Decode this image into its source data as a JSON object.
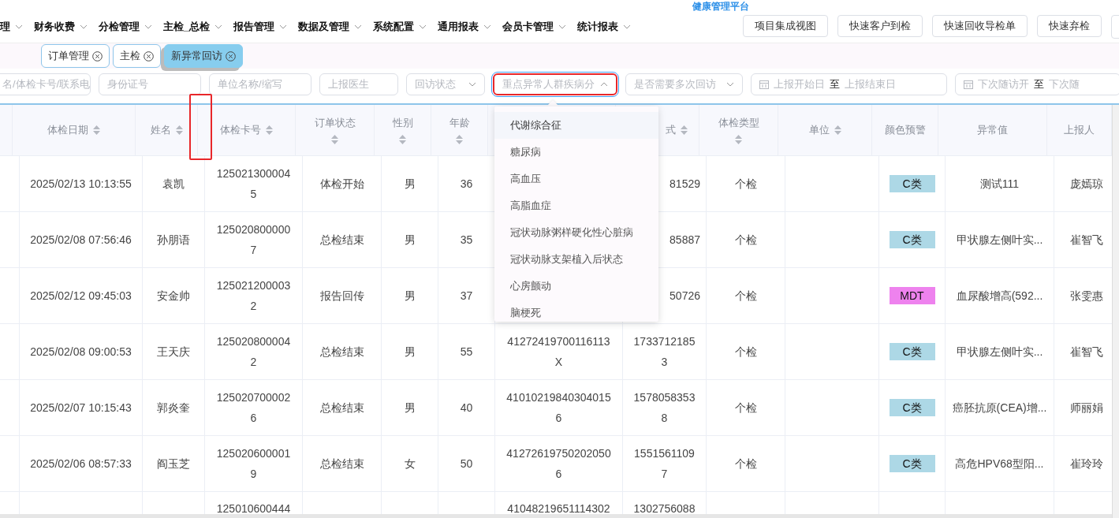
{
  "app_title": "健康管理平台",
  "nav": {
    "items": [
      {
        "label": "理"
      },
      {
        "label": "财务收费"
      },
      {
        "label": "分检管理"
      },
      {
        "label": "主检_总检"
      },
      {
        "label": "报告管理"
      },
      {
        "label": "数据及管理"
      },
      {
        "label": "系统配置"
      },
      {
        "label": "通用报表"
      },
      {
        "label": "会员卡管理"
      },
      {
        "label": "统计报表"
      }
    ],
    "buttons": [
      "项目集成视图",
      "快速客户到检",
      "快速回收导检单",
      "快速弃检"
    ]
  },
  "tabs": [
    {
      "label": "订单管理",
      "selected": false
    },
    {
      "label": "主检",
      "selected": false
    },
    {
      "label": "新异常回访",
      "selected": true
    }
  ],
  "filters": [
    {
      "kind": "text",
      "placeholder": "名/体检卡号/联系电",
      "highlighted": false
    },
    {
      "kind": "text",
      "placeholder": "身份证号",
      "highlighted": false
    },
    {
      "kind": "text",
      "placeholder": "单位名称/缩写",
      "highlighted": false
    },
    {
      "kind": "text",
      "placeholder": "上报医生",
      "highlighted": false
    },
    {
      "kind": "select",
      "placeholder": "回访状态",
      "open": false,
      "highlighted": false
    },
    {
      "kind": "select",
      "placeholder": "重点异常人群疾病分",
      "open": true,
      "highlighted": true
    },
    {
      "kind": "select",
      "placeholder": "是否需要多次回访",
      "open": false,
      "highlighted": false
    },
    {
      "kind": "daterange",
      "start_placeholder": "上报开始日",
      "separator": "至",
      "end_placeholder": "上报结束日",
      "highlighted": false
    },
    {
      "kind": "daterange",
      "start_placeholder": "下次随访开",
      "separator": "至",
      "end_placeholder": "下次随",
      "highlighted": false
    }
  ],
  "dropdown": {
    "options": [
      {
        "label": "代谢综合征",
        "highlighted": true
      },
      {
        "label": "糖尿病",
        "highlighted": false
      },
      {
        "label": "高血压",
        "highlighted": false
      },
      {
        "label": "高脂血症",
        "highlighted": false
      },
      {
        "label": "冠状动脉粥样硬化性心脏病",
        "highlighted": false
      },
      {
        "label": "冠状动脉支架植入后状态",
        "highlighted": false
      },
      {
        "label": "心房颤动",
        "highlighted": false
      },
      {
        "label": "脑梗死",
        "highlighted": false
      }
    ]
  },
  "table": {
    "columns": [
      {
        "kind": "inline",
        "sortable": false
      },
      {
        "kind": "inline",
        "label": "体检日期",
        "sortable": true
      },
      {
        "kind": "inline",
        "label": "姓名",
        "sortable": true
      },
      {
        "kind": "inline",
        "label": "体检卡号",
        "sortable": true
      },
      {
        "kind": "stacked",
        "label": "订单状态",
        "sortable": true
      },
      {
        "kind": "stacked",
        "label": "性别",
        "sortable": true
      },
      {
        "kind": "stacked",
        "label": "年龄",
        "sortable": true
      },
      {
        "kind": "inline"
      },
      {
        "kind": "covered",
        "label": "式",
        "sortable": true
      },
      {
        "kind": "stacked",
        "label": "体检类型",
        "sortable": true
      },
      {
        "kind": "inline",
        "label": "单位",
        "sortable": true
      },
      {
        "kind": "inline",
        "label": "颜色预警",
        "sortable": false
      },
      {
        "kind": "inline",
        "label": "异常值",
        "sortable": false
      },
      {
        "kind": "inline",
        "label": "上报人",
        "sortable": false
      }
    ],
    "rows": [
      {
        "kind": "covered",
        "date": "2025/02/13 10:13:55",
        "name": "袁凯",
        "card_no": "1250213000045",
        "status": "体检开始",
        "gender": "男",
        "age": "36",
        "phone": "81529",
        "exam_type": "个检",
        "warning": {
          "label": "C类",
          "color": "#add8e6"
        },
        "abnormal": "测试111",
        "reporter": "庞嫣琼"
      },
      {
        "kind": "covered",
        "date": "2025/02/08 07:56:46",
        "name": "孙朋语",
        "card_no": "1250208000007",
        "status": "总检结束",
        "gender": "男",
        "age": "35",
        "phone": "85887",
        "exam_type": "个检",
        "warning": {
          "label": "C类",
          "color": "#add8e6"
        },
        "abnormal": "甲状腺左侧叶实...",
        "reporter": "崔智飞"
      },
      {
        "kind": "covered",
        "date": "2025/02/12 09:45:03",
        "name": "安金帅",
        "card_no": "1250212000032",
        "status": "报告回传",
        "gender": "男",
        "age": "37",
        "phone": "50726",
        "exam_type": "个检",
        "warning": {
          "label": "MDT",
          "color": "#ee82ee"
        },
        "abnormal": "血尿酸增高(592...",
        "reporter": "张雯惠"
      },
      {
        "kind": "full",
        "date": "2025/02/08 09:00:53",
        "name": "王天庆",
        "card_no": "1250208000042",
        "status": "总检结束",
        "gender": "男",
        "age": "55",
        "id_no": "41272419700116113X",
        "phone": "17337121853",
        "exam_type": "个检",
        "warning": {
          "label": "C类",
          "color": "#add8e6"
        },
        "abnormal": "甲状腺左侧叶实...",
        "reporter": "崔智飞"
      },
      {
        "kind": "full",
        "date": "2025/02/07 10:15:43",
        "name": "郭炎奎",
        "card_no": "1250207000026",
        "status": "总检结束",
        "gender": "男",
        "age": "40",
        "id_no": "410102198403040156",
        "phone": "15780583538",
        "exam_type": "个检",
        "warning": {
          "label": "C类",
          "color": "#add8e6"
        },
        "abnormal": "癌胚抗原(CEA)增...",
        "reporter": "师丽娟"
      },
      {
        "kind": "full",
        "date": "2025/02/06 08:57:33",
        "name": "阎玉芝",
        "card_no": "1250206000019",
        "status": "总检结束",
        "gender": "女",
        "age": "50",
        "id_no": "412726197502020506",
        "phone": "15515611097",
        "exam_type": "个检",
        "warning": {
          "label": "C类",
          "color": "#add8e6"
        },
        "abnormal": "高危HPV68型阳...",
        "reporter": "崔玲玲"
      },
      {
        "kind": "partial",
        "card_no": "125010600444",
        "id_no": "41048219651114302",
        "phone": "1302756088"
      }
    ]
  }
}
